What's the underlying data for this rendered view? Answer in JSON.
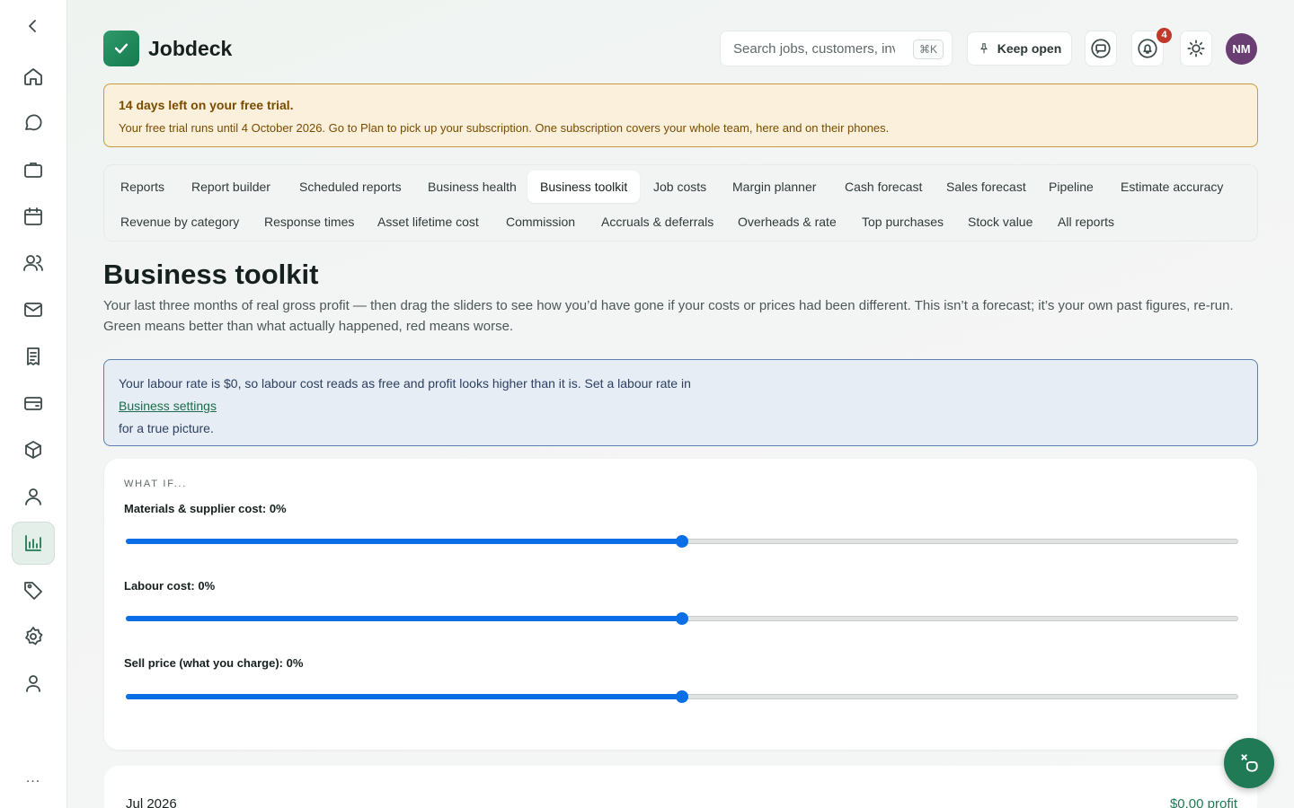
{
  "app": {
    "name": "Jobdeck"
  },
  "header": {
    "search_placeholder": "Search jobs, customers, invoices",
    "search_shortcut": "⌘K",
    "keep_open_label": "Keep open",
    "notification_count": "4",
    "avatar_initials": "NM"
  },
  "sidebar": {
    "more_label": "...",
    "items": [
      {
        "icon": "back-chevron-icon"
      },
      {
        "icon": "home-icon"
      },
      {
        "icon": "chat-icon"
      },
      {
        "icon": "briefcase-icon"
      },
      {
        "icon": "calendar-icon"
      },
      {
        "icon": "team-icon"
      },
      {
        "icon": "mail-icon"
      },
      {
        "icon": "invoice-icon"
      },
      {
        "icon": "card-icon"
      },
      {
        "icon": "box-icon"
      },
      {
        "icon": "customer-icon"
      },
      {
        "icon": "reports-icon",
        "active": true
      },
      {
        "icon": "tag-icon"
      },
      {
        "icon": "settings-icon"
      },
      {
        "icon": "profile-icon"
      }
    ]
  },
  "trial": {
    "title": "14 days left on your free trial.",
    "body": "Your free trial runs until 4 October 2026. Go to Plan to pick up your subscription. One subscription covers your whole team, here and on their phones."
  },
  "tabs": {
    "row1": [
      "Reports",
      "Report builder",
      "Scheduled reports",
      "Business health",
      "Business toolkit",
      "Job costs",
      "Margin planner",
      "Cash forecast",
      "Sales forecast",
      "Pipeline",
      "Estimate accuracy"
    ],
    "row2": [
      "Revenue by category",
      "Response times",
      "Asset lifetime cost",
      "Commission",
      "Accruals & deferrals",
      "Overheads & rate",
      "Top purchases",
      "Stock value",
      "All reports"
    ],
    "active": "Business toolkit"
  },
  "page": {
    "title": "Business toolkit",
    "description": "Your last three months of real gross profit — then drag the sliders to see how you’d have gone if your costs or prices had been different. This isn’t a forecast; it’s your own past figures, re-run. Green means better than what actually happened, red means worse."
  },
  "info": {
    "text_before": "Your labour rate is $0, so labour cost reads as free and profit looks higher than it is. Set a labour rate in",
    "link": "Business settings",
    "text_after": "for a true picture."
  },
  "what_if": {
    "label": "WHAT IF...",
    "sliders": [
      {
        "label": "Materials & supplier cost: 0%",
        "position": 0.5
      },
      {
        "label": "Labour cost: 0%",
        "position": 0.5
      },
      {
        "label": "Sell price (what you charge): 0%",
        "position": 0.5
      }
    ]
  },
  "month": {
    "name": "Jul 2026",
    "profit": "$0.00 profit"
  },
  "colors": {
    "brand": "#1f7a55",
    "slider": "#0a6ee6",
    "trial_bg": "#fbf0dc",
    "info_bg": "#e6edf5"
  }
}
